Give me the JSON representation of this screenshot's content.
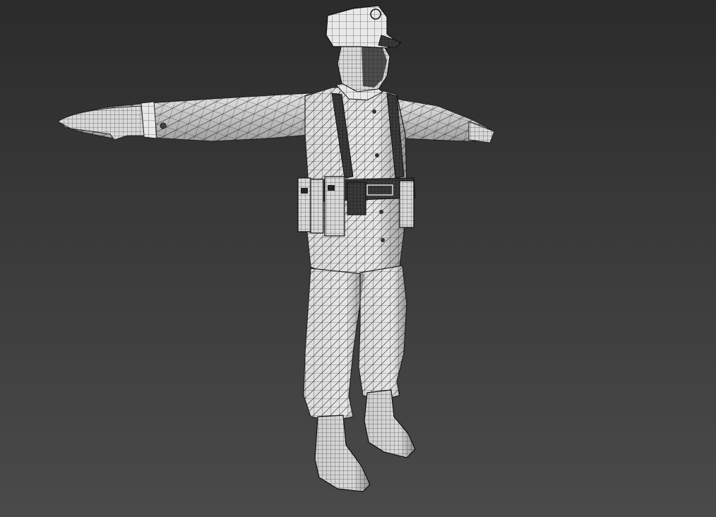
{
  "viewport": {
    "background_top": "#2b2b2b",
    "background_bottom": "#4a4a4a",
    "mesh_fill": "#e8e8e8",
    "mesh_shadow": "#9a9a9a",
    "wire_color": "#1a1a1a",
    "dark_part": "#2a2a2a"
  },
  "model": {
    "pose": "t-pose",
    "parts": [
      "cap",
      "head",
      "torso",
      "left-arm",
      "right-arm",
      "belt",
      "ammo-pouches",
      "suspenders",
      "trousers",
      "boots"
    ],
    "shading": "wireframe-over-shaded"
  }
}
